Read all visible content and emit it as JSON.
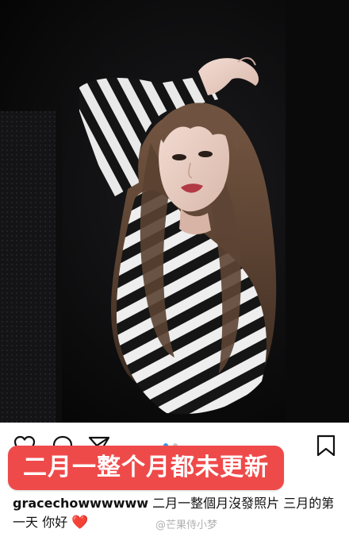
{
  "post": {
    "photo_alt": "photo",
    "carousel": {
      "count": 2,
      "active_index": 0
    }
  },
  "actions": {
    "like_icon": "heart-outline-icon",
    "comment_icon": "comment-bubble-icon",
    "share_icon": "paper-plane-icon",
    "save_icon": "bookmark-icon"
  },
  "banner": {
    "text": "二月一整个月都未更新",
    "color": "#ef4a4a"
  },
  "caption": {
    "username": "gracechowwwwww",
    "text": " 二月一整個月沒發照片 三月的第一天 你好 ",
    "emoji": "❤️"
  },
  "watermark": {
    "text": "@芒果侍小梦"
  },
  "colors": {
    "accent_dot": "#3897f0",
    "heart": "#e8232a"
  }
}
